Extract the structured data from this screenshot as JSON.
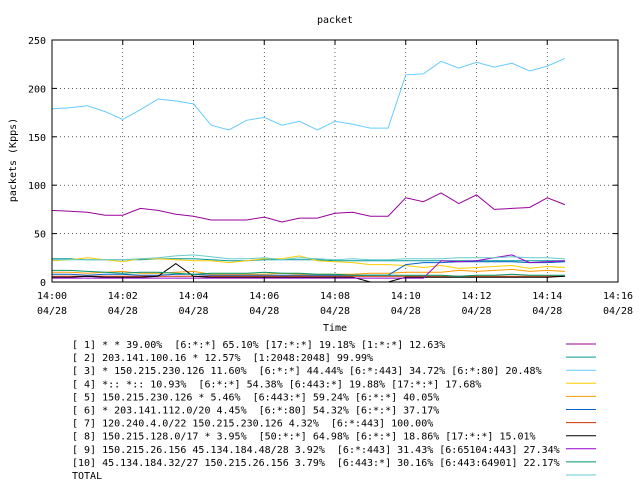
{
  "chart_data": {
    "type": "line",
    "title": "packet",
    "xlabel": "Time",
    "ylabel": "packets (Kpps)",
    "ylim": [
      0,
      250
    ],
    "yticks": [
      0,
      50,
      100,
      150,
      200,
      250
    ],
    "xlim": [
      "2024-04-28T14:00",
      "2024-04-28T14:16"
    ],
    "xticks": [
      {
        "time": "14:00",
        "date": "04/28"
      },
      {
        "time": "14:02",
        "date": "04/28"
      },
      {
        "time": "14:04",
        "date": "04/28"
      },
      {
        "time": "14:06",
        "date": "04/28"
      },
      {
        "time": "14:08",
        "date": "04/28"
      },
      {
        "time": "14:10",
        "date": "04/28"
      },
      {
        "time": "14:12",
        "date": "04/28"
      },
      {
        "time": "14:14",
        "date": "04/28"
      },
      {
        "time": "14:16",
        "date": "04/28"
      }
    ],
    "grid": true,
    "legend_position": "bottom",
    "x": [
      "14:00",
      "14:00:30",
      "14:01",
      "14:01:30",
      "14:02",
      "14:02:30",
      "14:03",
      "14:03:30",
      "14:04",
      "14:04:30",
      "14:05",
      "14:05:30",
      "14:06",
      "14:06:30",
      "14:07",
      "14:07:30",
      "14:08",
      "14:08:30",
      "14:09",
      "14:09:30",
      "14:10",
      "14:10:30",
      "14:11",
      "14:11:30",
      "14:12",
      "14:12:30",
      "14:13",
      "14:13:30",
      "14:14",
      "14:14:30"
    ],
    "series": [
      {
        "name": "[ 1] * * 39.00%  [6:*:*] 65.10% [17:*:*] 19.18% [1:*:*] 12.63%",
        "color": "#990099",
        "values": [
          74,
          73,
          72,
          69,
          69,
          76,
          74,
          70,
          68,
          64,
          64,
          64,
          67,
          62,
          66,
          66,
          71,
          72,
          68,
          68,
          87,
          83,
          92,
          81,
          90,
          75,
          76,
          77,
          87,
          80
        ]
      },
      {
        "name": "[ 2] 203.141.100.16 * 12.57%  [1:2048:2048] 99.99%",
        "color": "#009999",
        "values": [
          24,
          24,
          23,
          23,
          23,
          23,
          24,
          24,
          24,
          23,
          22,
          22,
          23,
          23,
          23,
          23,
          22,
          22,
          22,
          22,
          22,
          22,
          22,
          22,
          22,
          22,
          22,
          22,
          22,
          22
        ]
      },
      {
        "name": "[ 3] * 150.215.230.126 11.60%  [6:*:*] 44.44% [6:*:443] 34.72% [6:*:80] 20.48%",
        "color": "#66ccff",
        "values": [
          179,
          180,
          182,
          176,
          168,
          178,
          189,
          187,
          184,
          162,
          157,
          167,
          170,
          162,
          166,
          157,
          166,
          163,
          159,
          159,
          214,
          215,
          228,
          221,
          227,
          222,
          226,
          218,
          223,
          231
        ]
      },
      {
        "name": "[ 4] *:: *:: 10.93%  [6:*:*] 54.38% [6:443:*] 19.88% [17:*:*] 17.68%",
        "color": "#ffcc00",
        "values": [
          22,
          23,
          25,
          23,
          21,
          24,
          24,
          23,
          22,
          22,
          20,
          22,
          24,
          24,
          27,
          22,
          21,
          20,
          18,
          18,
          17,
          15,
          17,
          14,
          15,
          16,
          17,
          14,
          16,
          15
        ]
      },
      {
        "name": "[ 5] 150.215.230.126 * 5.46%  [6:443:*] 59.24% [6:*:*] 40.05%",
        "color": "#ff9900",
        "values": [
          10,
          10,
          9,
          10,
          11,
          9,
          9,
          10,
          11,
          8,
          8,
          8,
          8,
          9,
          8,
          8,
          8,
          8,
          9,
          9,
          10,
          10,
          10,
          12,
          11,
          12,
          13,
          11,
          12,
          11
        ]
      },
      {
        "name": "[ 6] * 203.141.112.0/20 4.45%  [6:*:80] 54.32% [6:*:*] 37.17%",
        "color": "#0066cc",
        "values": [
          8,
          8,
          7,
          8,
          8,
          7,
          7,
          8,
          8,
          7,
          7,
          7,
          7,
          7,
          7,
          7,
          7,
          7,
          7,
          7,
          18,
          20,
          20,
          21,
          21,
          21,
          21,
          20,
          20,
          21
        ]
      },
      {
        "name": "[ 7] 120.240.4.0/22 150.215.230.126 4.32%  [6:*:443] 100.00%",
        "color": "#cc3300",
        "values": [
          6,
          6,
          6,
          6,
          6,
          6,
          6,
          6,
          6,
          6,
          6,
          6,
          6,
          6,
          6,
          6,
          6,
          6,
          6,
          6,
          6,
          6,
          6,
          6,
          6,
          6,
          6,
          6,
          6,
          6
        ]
      },
      {
        "name": "[ 8] 150.215.128.0/17 * 3.95%  [50:*:*] 64.98% [6:*:*] 18.86% [17:*:*] 15.01%",
        "color": "#000000",
        "values": [
          5,
          5,
          6,
          5,
          5,
          5,
          6,
          19,
          6,
          5,
          5,
          5,
          5,
          5,
          5,
          5,
          5,
          5,
          0,
          0,
          5,
          5,
          5,
          5,
          5,
          5,
          5,
          5,
          5,
          6
        ]
      },
      {
        "name": "[ 9] 150.215.26.156 45.134.184.48/28 3.92%  [6:*:443] 31.43% [6:65104:443] 27.34%",
        "color": "#9900cc",
        "values": [
          4,
          4,
          4,
          4,
          4,
          4,
          4,
          4,
          4,
          4,
          4,
          4,
          4,
          4,
          4,
          4,
          4,
          4,
          4,
          4,
          4,
          4,
          22,
          21,
          22,
          25,
          28,
          20,
          21,
          22
        ]
      },
      {
        "name": "[10] 45.134.184.32/27 150.215.26.156 3.79%  [6:443:*] 30.16% [6:443:64901] 22.17%",
        "color": "#009966",
        "values": [
          12,
          12,
          11,
          10,
          9,
          10,
          10,
          9,
          8,
          9,
          9,
          9,
          10,
          9,
          9,
          8,
          8,
          7,
          7,
          7,
          7,
          7,
          7,
          6,
          7,
          7,
          8,
          7,
          7,
          7
        ]
      },
      {
        "name": "TOTAL",
        "color": "#66cccc",
        "values": [
          23,
          23,
          23,
          23,
          23,
          24,
          25,
          27,
          28,
          26,
          24,
          24,
          25,
          23,
          25,
          24,
          23,
          24,
          23,
          23,
          24,
          24,
          24,
          25,
          25,
          25,
          26,
          25,
          25,
          24
        ]
      }
    ]
  }
}
